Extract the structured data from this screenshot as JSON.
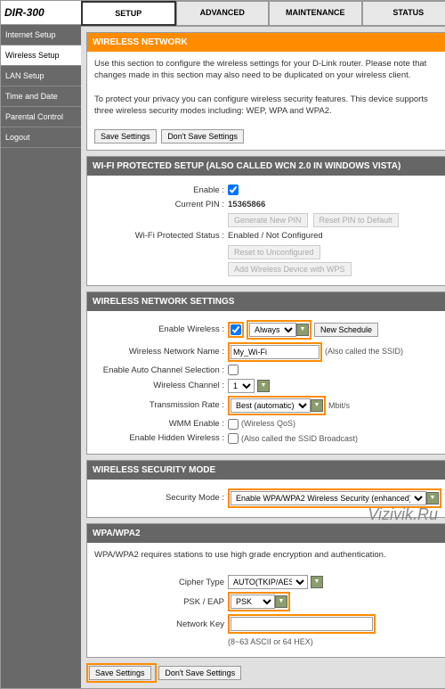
{
  "logo": "DIR-300",
  "sidebar": {
    "items": [
      "Internet Setup",
      "Wireless Setup",
      "LAN Setup",
      "Time and Date",
      "Parental Control",
      "Logout"
    ]
  },
  "tabs": [
    "SETUP",
    "ADVANCED",
    "MAINTENANCE",
    "STATUS"
  ],
  "wn": {
    "title": "WIRELESS NETWORK",
    "desc1": "Use this section to configure the wireless settings for your D-Link router. Please note that changes made in this section may also need to be duplicated on your wireless client.",
    "desc2": "To protect your privacy you can configure wireless security features. This device supports three wireless security modes including: WEP, WPA and WPA2.",
    "save": "Save Settings",
    "dont": "Don't Save Settings"
  },
  "wps": {
    "title": "WI-FI PROTECTED SETUP (ALSO CALLED WCN 2.0 IN WINDOWS VISTA)",
    "enable": "Enable :",
    "pin_l": "Current PIN :",
    "pin": "15365866",
    "gen": "Generate New PIN",
    "reset": "Reset PIN to Default",
    "status_l": "Wi-Fi Protected Status :",
    "status": "Enabled / Not Configured",
    "resetun": "Reset to Unconfigured",
    "addwps": "Add Wireless Device with WPS"
  },
  "wns": {
    "title": "WIRELESS NETWORK SETTINGS",
    "ew": "Enable Wireless :",
    "always": "Always",
    "newsched": "New Schedule",
    "name_l": "Wireless Network Name :",
    "name": "My_Wi-Fi",
    "ssid": "(Also called the SSID)",
    "auto": "Enable Auto Channel Selection :",
    "ch_l": "Wireless Channel :",
    "ch": "1",
    "rate_l": "Transmission Rate :",
    "rate": "Best (automatic)",
    "mbit": "Mbit/s",
    "wmm_l": "WMM Enable :",
    "wmm": "(Wireless QoS)",
    "hid_l": "Enable Hidden Wireless :",
    "hid": "(Also called the SSID Broadcast)"
  },
  "sec": {
    "title": "WIRELESS SECURITY MODE",
    "mode_l": "Security Mode :",
    "mode": "Enable WPA/WPA2 Wireless Security (enhanced)"
  },
  "wpa": {
    "title": "WPA/WPA2",
    "desc": "WPA/WPA2 requires stations to use high grade encryption and authentication.",
    "cipher_l": "Cipher Type",
    "cipher": "AUTO(TKIP/AES)",
    "psk_l": "PSK / EAP",
    "psk": "PSK",
    "key_l": "Network Key",
    "key": "",
    "hint": "(8~63 ASCII or 64 HEX)"
  },
  "footer": {
    "save": "Save Settings",
    "dont": "Don't Save Settings"
  },
  "watermark": "Vizivik.Ru"
}
